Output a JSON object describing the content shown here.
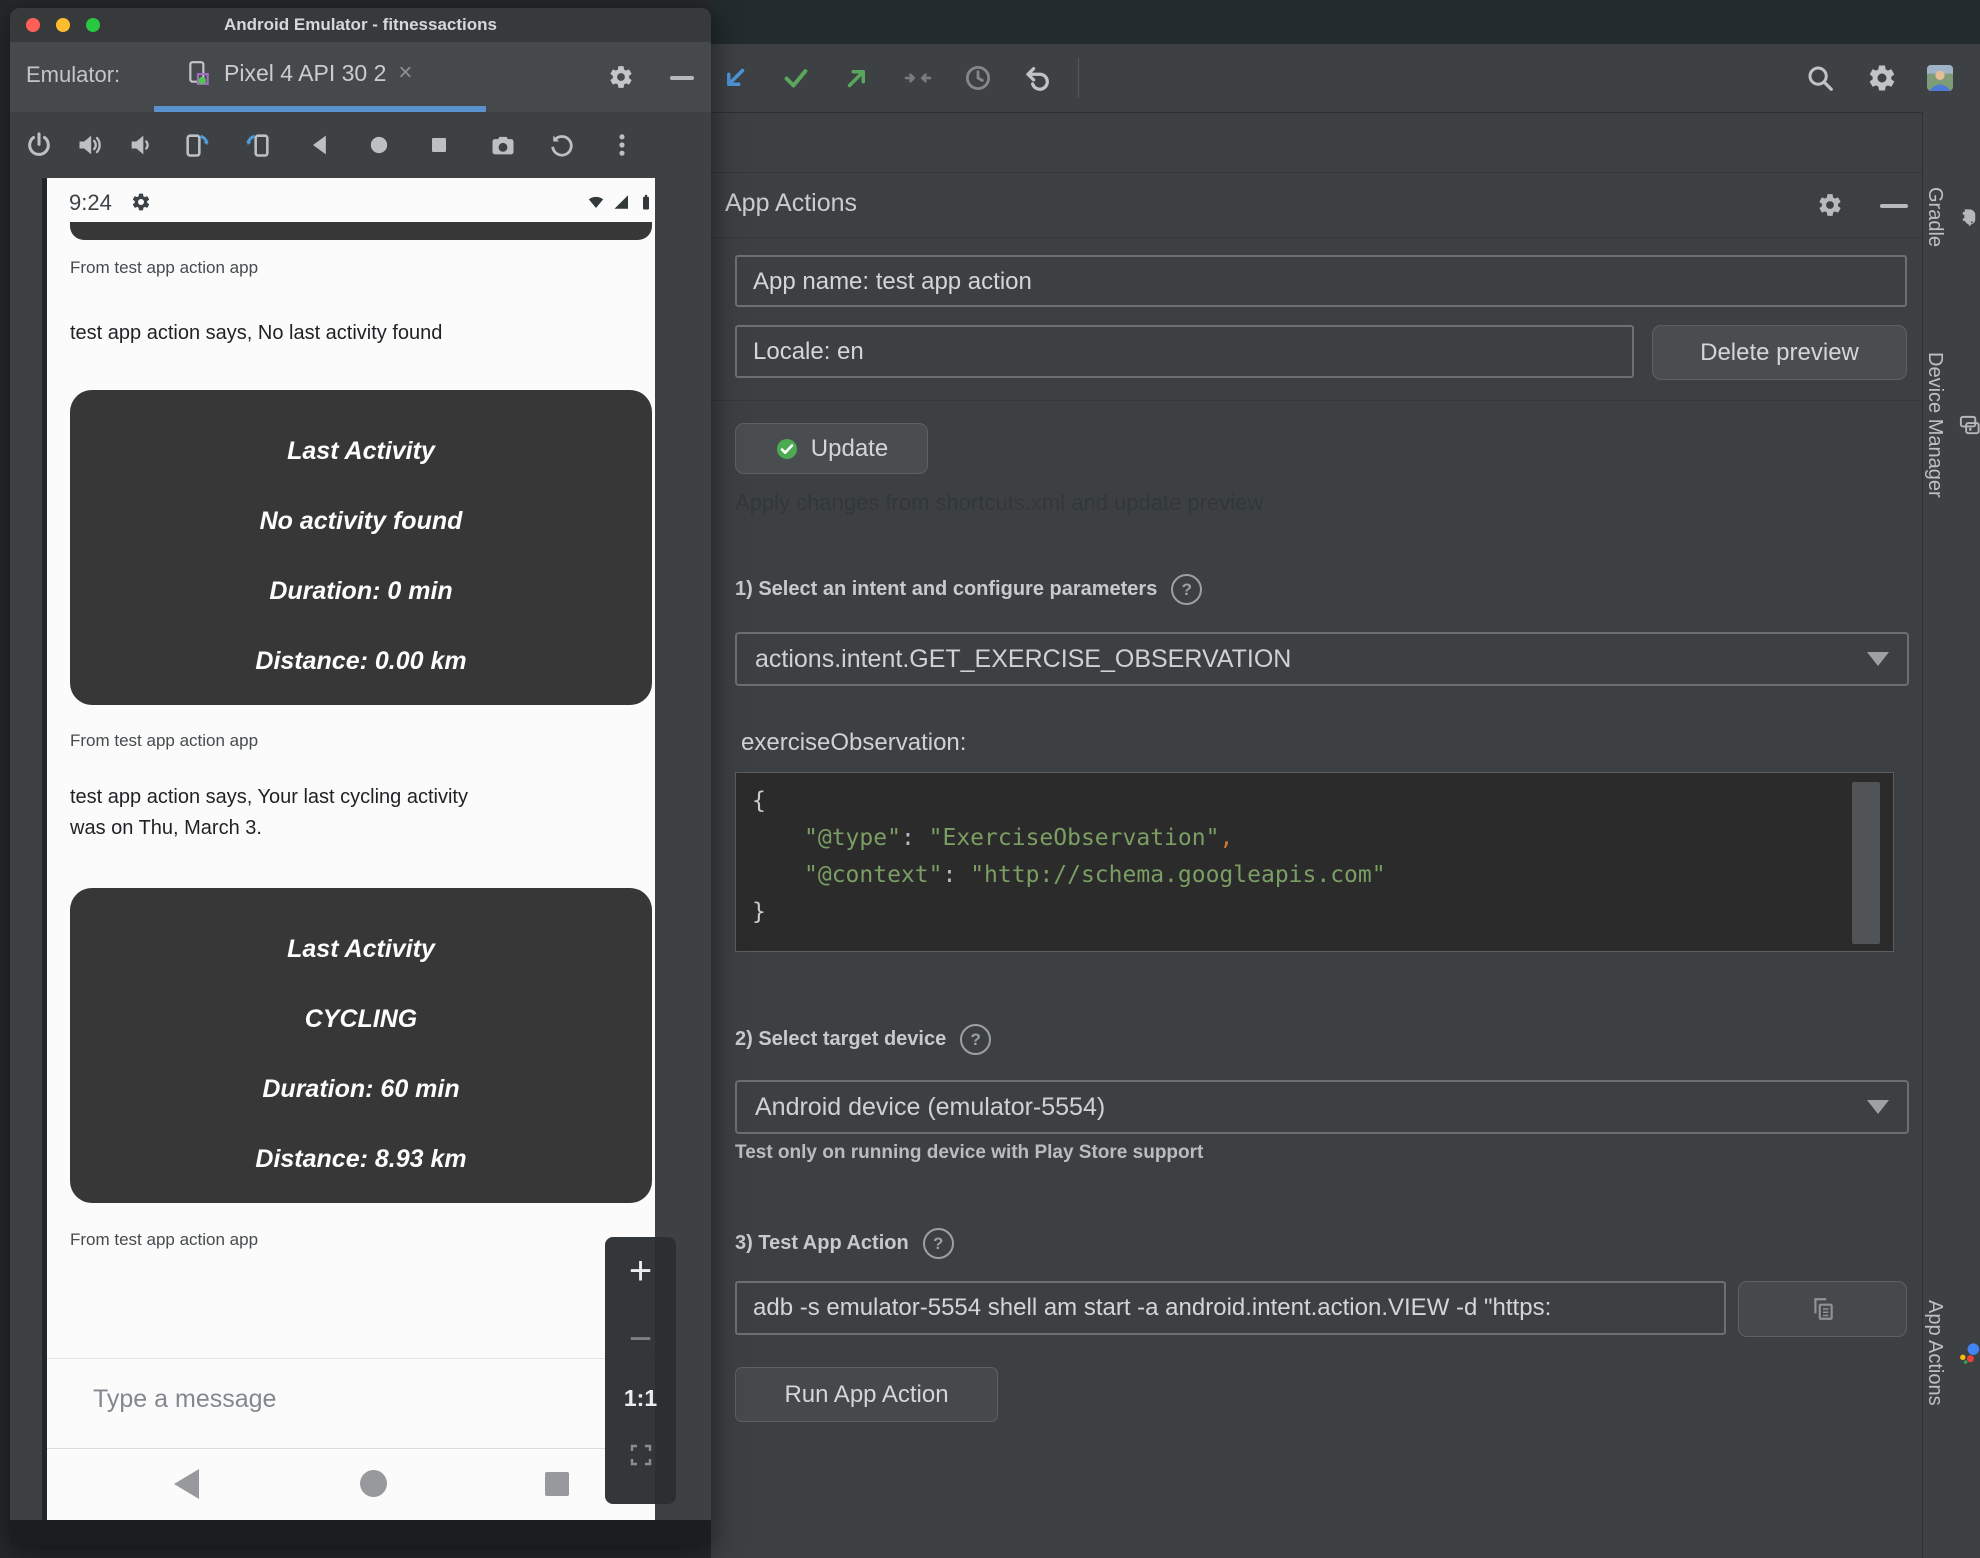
{
  "emulator": {
    "window_title": "Android Emulator - fitnessactions",
    "tab_bar": {
      "label": "Emulator:",
      "tab_title": "Pixel 4 API 30 2",
      "close_glyph": "×"
    },
    "phone": {
      "status_time": "9:24",
      "sender_label": "From test app action app",
      "message_no_activity": "test app action says, No last activity found",
      "message_cycling_line1": "test app action says, Your last cycling activity",
      "message_cycling_line2": "was on Thu, March 3.",
      "card_no_activity": {
        "title": "Last Activity",
        "activity": "No activity found",
        "duration": "Duration: 0 min",
        "distance": "Distance: 0.00 km"
      },
      "card_cycling": {
        "title": "Last Activity",
        "activity": "CYCLING",
        "duration": "Duration: 60 min",
        "distance": "Distance: 8.93 km"
      },
      "input_placeholder": "Type a message",
      "zoom_panel": {
        "zoom_in": "+",
        "zoom_out": "−",
        "ratio": "1:1"
      }
    }
  },
  "studio": {
    "panel": {
      "title": "App Actions",
      "help_glyph": "?",
      "app_name_value": "App name: test app action",
      "locale_value": "Locale: en",
      "delete_preview_label": "Delete preview",
      "update_label": "Update",
      "dim_hint": "Apply changes from shortcuts.xml and update preview",
      "section_intent": {
        "label": "1) Select an intent and configure parameters",
        "dropdown_value": "actions.intent.GET_EXERCISE_OBSERVATION",
        "param_label": "exerciseObservation:",
        "code": {
          "open_brace": "{",
          "line1_key": "\"@type\"",
          "line1_sep": ": ",
          "line1_value": "\"ExerciseObservation\"",
          "line1_comma": ",",
          "line2_key": "\"@context\"",
          "line2_sep": ": ",
          "line2_value": "\"http://schema.googleapis.com\"",
          "close_brace": "}"
        }
      },
      "section_device": {
        "label": "2) Select target device",
        "dropdown_value": "Android device (emulator-5554)",
        "hint": "Test only on running device with Play Store support"
      },
      "section_test": {
        "label": "3) Test App Action",
        "command_value": "adb -s emulator-5554 shell am start -a android.intent.action.VIEW -d \"https:",
        "run_label": "Run App Action"
      }
    },
    "sidebar": {
      "gradle": "Gradle",
      "device_manager": "Device Manager",
      "app_actions": "App Actions"
    },
    "colors": {
      "accent_blue": "#5a91cf",
      "vcs_green": "#59a65c",
      "code_string": "#7a9e63",
      "code_comma": "#cc7832",
      "assistant_blue": "#4285f4",
      "assistant_red": "#ea4335",
      "assistant_yellow": "#fbbc05",
      "assistant_green": "#34a853"
    }
  }
}
